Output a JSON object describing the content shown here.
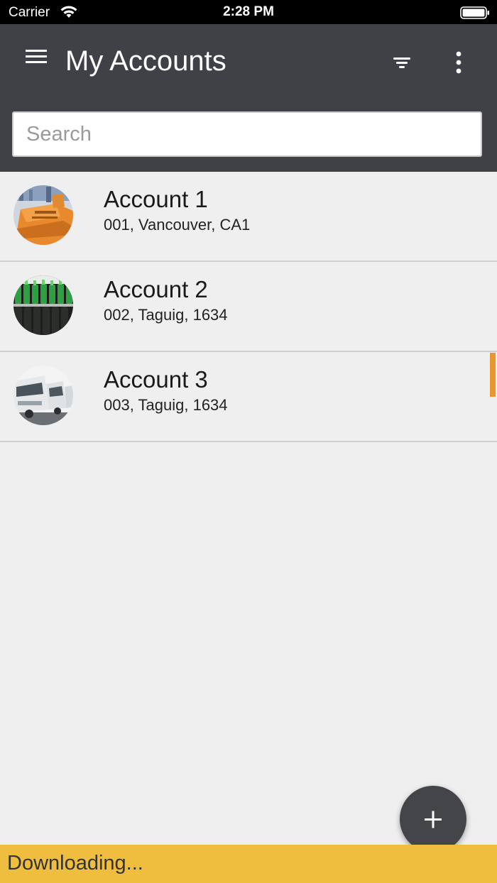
{
  "status_bar": {
    "carrier": "Carrier",
    "time": "2:28 PM",
    "wifi_icon": "wifi-icon",
    "battery_icon": "battery-full-icon"
  },
  "app_bar": {
    "title": "My Accounts",
    "menu_icon": "hamburger-menu-icon",
    "filter_icon": "filter-icon",
    "more_icon": "more-vertical-icon",
    "background_color": "#404146"
  },
  "search": {
    "placeholder": "Search",
    "value": ""
  },
  "accounts": [
    {
      "name": "Account 1",
      "address": "001, Vancouver, CA1",
      "image": "construction-loader-photo"
    },
    {
      "name": "Account 2",
      "address": "002, Taguig, 1634",
      "image": "green-bottles-photo"
    },
    {
      "name": "Account 3",
      "address": "003, Taguig, 1634",
      "image": "white-trucks-photo"
    }
  ],
  "fab": {
    "icon": "plus-icon"
  },
  "download_bar": {
    "text": "Downloading...",
    "color": "#f0be3f"
  },
  "accent_color": "#e8972f"
}
